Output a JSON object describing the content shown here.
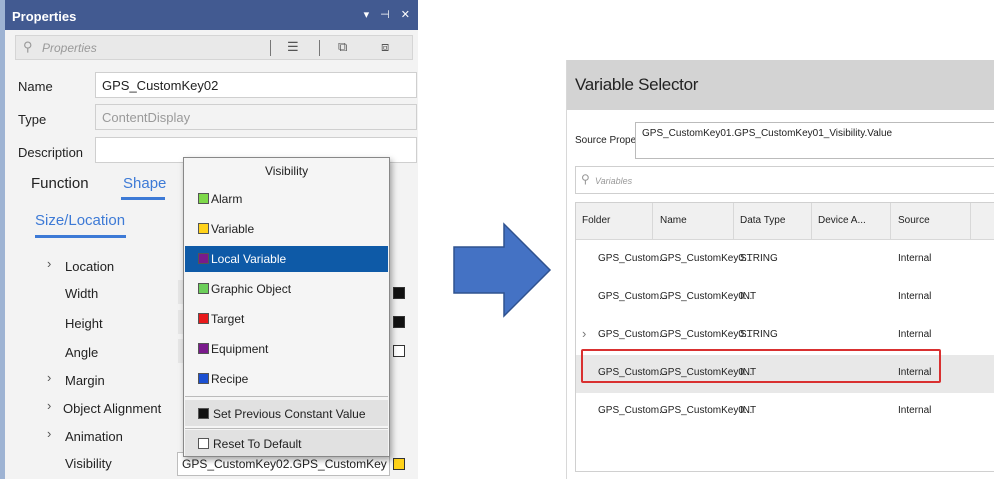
{
  "properties": {
    "title": "Properties",
    "title_icons": "▾ ⊣ ✕",
    "search_placeholder": "Properties",
    "name_label": "Name",
    "name_value": "GPS_CustomKey02",
    "type_label": "Type",
    "type_value": "ContentDisplay",
    "description_label": "Description",
    "description_value": "",
    "tabs": [
      "Function",
      "Shape"
    ],
    "subtab": "Size/Location",
    "rows": {
      "location": "Location",
      "width": "Width",
      "height": "Height",
      "angle": "Angle",
      "margin": "Margin",
      "object_alignment": "Object Alignment",
      "animation": "Animation",
      "visibility": "Visibility"
    },
    "visibility_value": "GPS_CustomKey02.GPS_CustomKey"
  },
  "visibility_menu": {
    "header": "Visibility",
    "items": [
      {
        "label": "Alarm",
        "color": "#7ed94a"
      },
      {
        "label": "Variable",
        "color": "#ffd21a"
      },
      {
        "label": "Local Variable",
        "color": "#7a1a8c"
      },
      {
        "label": "Graphic Object",
        "color": "#6ccf5a"
      },
      {
        "label": "Target",
        "color": "#e8191b"
      },
      {
        "label": "Equipment",
        "color": "#7a1a8c"
      },
      {
        "label": "Recipe",
        "color": "#1b4fd1"
      }
    ],
    "selected": "Local Variable",
    "set_previous": "Set Previous Constant Value",
    "reset": "Reset To Default"
  },
  "variable_selector": {
    "title": "Variable Selector",
    "source_property_label": "Source Property",
    "source_property_value": "GPS_CustomKey01.GPS_CustomKey01_Visibility.Value",
    "search_placeholder": "Variables",
    "columns": [
      "Folder",
      "Name",
      "Data Type",
      "Device A...",
      "Source"
    ],
    "rows": [
      {
        "folder": "GPS_Custom...",
        "name": "GPS_CustomKey0...",
        "data_type": "STRING",
        "source": "Internal"
      },
      {
        "folder": "GPS_Custom...",
        "name": "GPS_CustomKey0...",
        "data_type": "INT",
        "source": "Internal"
      },
      {
        "folder": "GPS_Custom...",
        "name": "GPS_CustomKey0...",
        "data_type": "STRING",
        "source": "Internal"
      },
      {
        "folder": "GPS_Custom...",
        "name": "GPS_CustomKey0...",
        "data_type": "INT",
        "source": "Internal"
      },
      {
        "folder": "GPS_Custom...",
        "name": "GPS_CustomKey0...",
        "data_type": "INT",
        "source": "Internal"
      }
    ]
  },
  "colors": {
    "title_bar": "#425a91",
    "accent": "#3d7ad6",
    "selected": "#0e5aa7",
    "arrow": "#4472c4",
    "highlight": "#d93030"
  }
}
